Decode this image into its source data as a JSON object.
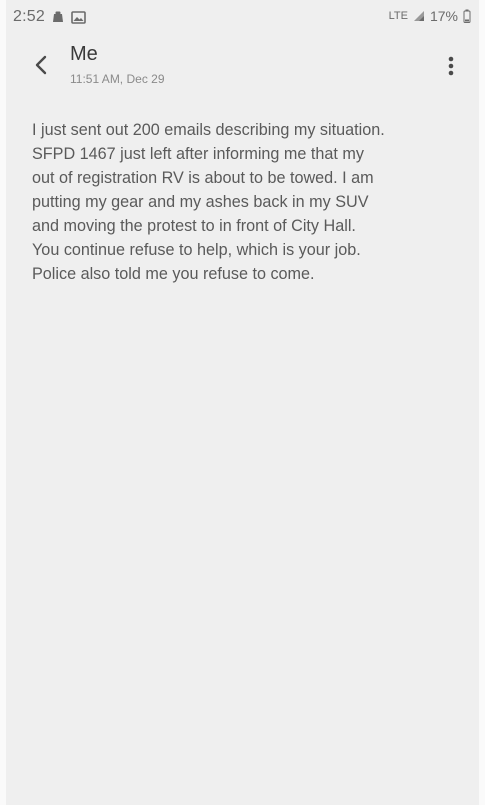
{
  "status_bar": {
    "time": "2:52",
    "network": "LTE",
    "battery_percent": "17%",
    "icons": [
      "notification-icon",
      "image-icon",
      "signal-icon",
      "battery-icon"
    ]
  },
  "header": {
    "title": "Me",
    "timestamp": "11:51 AM, Dec 29",
    "icons": [
      "back-arrow-icon",
      "more-options-icon"
    ]
  },
  "message": {
    "body": "I just sent out 200 emails describing my situation.\nSFPD 1467 just left after informing me that my\nout of registration RV is about to be towed.  I am\nputting my gear and my ashes back in my SUV\nand moving the protest to in front of City Hall.\nYou continue refuse to help, which is your job.\nPolice also told me you refuse to come."
  },
  "colors": {
    "background": "#efefef",
    "text": "#5a5a5a",
    "title": "#3a3a3a",
    "secondary_text": "#8a8a8a"
  }
}
